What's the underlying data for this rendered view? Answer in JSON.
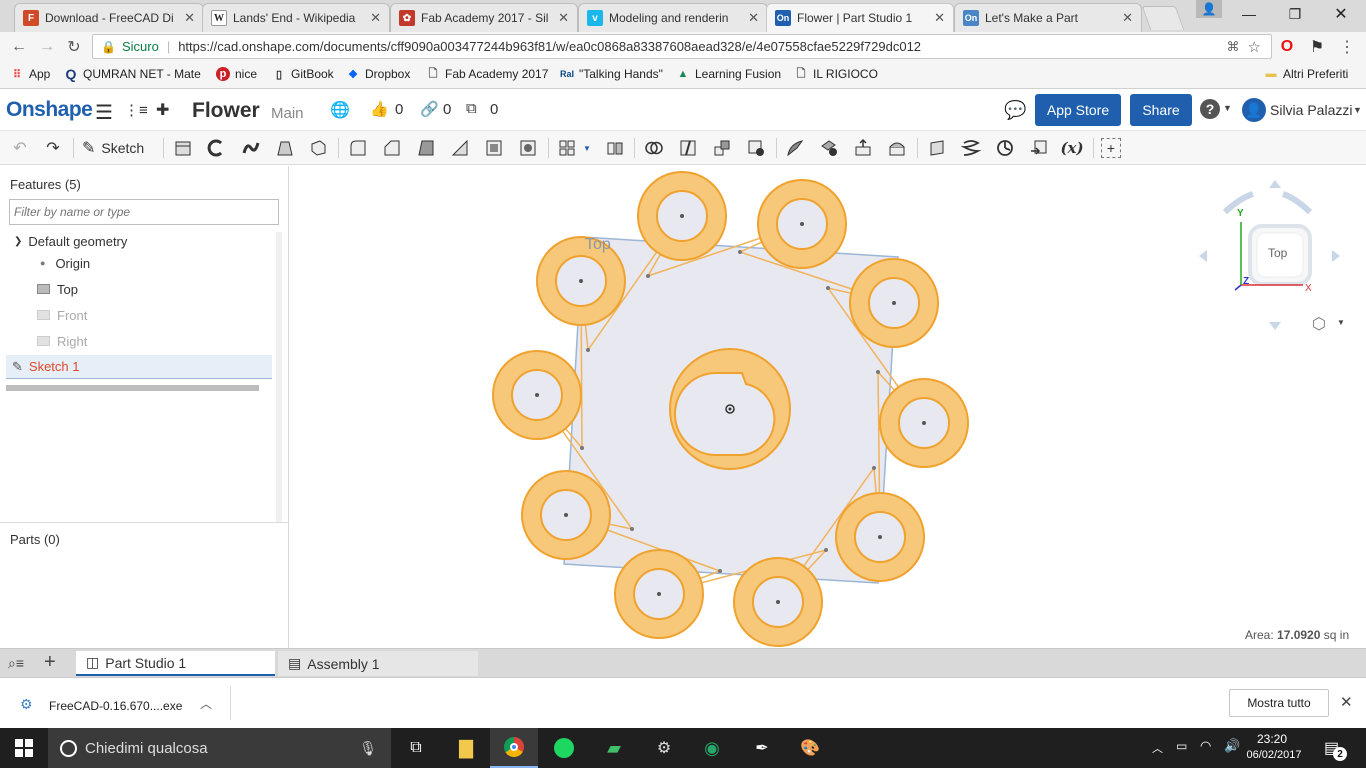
{
  "browser": {
    "tabs": [
      {
        "title": "Download - FreeCAD Di",
        "icon": "freecad-icon",
        "color": "#d04a2a"
      },
      {
        "title": "Lands' End - Wikipedia",
        "icon": "wikipedia-icon",
        "color": "#333333"
      },
      {
        "title": "Fab Academy 2017 - Sil",
        "icon": "fabacademy-icon",
        "color": "#c0392b"
      },
      {
        "title": "Modeling and renderin",
        "icon": "vimeo-icon",
        "color": "#1ab7ea"
      },
      {
        "title": "Flower | Part Studio 1",
        "icon": "onshape-icon",
        "color": "#1f5fae"
      },
      {
        "title": "Let's Make a Part",
        "icon": "onshape-icon",
        "color": "#4a86c6"
      }
    ],
    "secure_label": "Sicuro",
    "url": "https://cad.onshape.com/documents/cff9090a003477244b963f81/w/ea0c0868a83387608aead328/e/4e07558cfae5229f729dc012",
    "bookmarks": [
      {
        "label": "App",
        "icon": "apps-grid-icon"
      },
      {
        "label": "QUMRAN NET - Mate",
        "icon": "q-icon"
      },
      {
        "label": "nice",
        "icon": "pinterest-icon"
      },
      {
        "label": "GitBook",
        "icon": "gitbook-icon"
      },
      {
        "label": "Dropbox",
        "icon": "dropbox-icon"
      },
      {
        "label": "Fab Academy 2017",
        "icon": "page-icon"
      },
      {
        "label": "\"Talking Hands\"",
        "icon": "rai-icon"
      },
      {
        "label": "Learning Fusion",
        "icon": "autodesk-icon"
      },
      {
        "label": "IL RIGIOCO",
        "icon": "page-icon"
      }
    ],
    "other_bookmarks": "Altri Preferiti"
  },
  "onshape": {
    "logo": "Onshape",
    "doc_title": "Flower",
    "branch": "Main",
    "likes": "0",
    "links": "0",
    "copies": "0",
    "app_store": "App Store",
    "share": "Share",
    "user": "Silvia Palazzi",
    "sketch_label": "Sketch",
    "fx_label": "(x)"
  },
  "features": {
    "header": "Features (5)",
    "filter_placeholder": "Filter by name or type",
    "group": "Default geometry",
    "items": [
      {
        "label": "Origin"
      },
      {
        "label": "Top"
      },
      {
        "label": "Front"
      },
      {
        "label": "Right"
      }
    ],
    "sketch": "Sketch 1",
    "parts": "Parts (0)"
  },
  "viewport": {
    "plane_label": "Top",
    "viewcube_label": "Top",
    "axis_x": "X",
    "axis_y": "Y",
    "axis_z": "Z",
    "area_label": "Area:",
    "area_value": "17.0920",
    "area_unit": "sq in"
  },
  "bottom_tabs": [
    {
      "label": "Part Studio 1"
    },
    {
      "label": "Assembly 1"
    }
  ],
  "download": {
    "file": "FreeCAD-0.16.670....exe",
    "show_all": "Mostra tutto"
  },
  "taskbar": {
    "search_placeholder": "Chiedimi qualcosa",
    "time": "23:20",
    "date": "06/02/2017",
    "notifications": "2"
  },
  "colors": {
    "onshape_blue": "#1f5fae",
    "sketch_red": "#e0492a",
    "sketch_fill": "#f7c77a",
    "sketch_stroke": "#f0a22e"
  }
}
